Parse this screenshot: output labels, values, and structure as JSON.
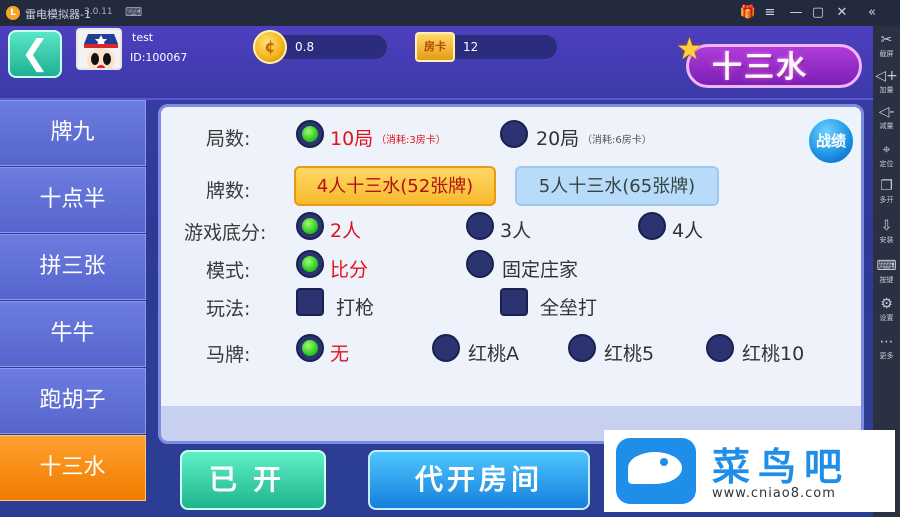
{
  "window": {
    "title": "雷电模拟器-1",
    "version": "3.0.11",
    "controls": [
      "🎁",
      "≡",
      "—",
      "▢",
      "✕",
      "«"
    ]
  },
  "toolbar": [
    {
      "icon": "✂",
      "label": "截屏"
    },
    {
      "icon": "◁+",
      "label": "加量"
    },
    {
      "icon": "◁-",
      "label": "减量"
    },
    {
      "icon": "⌖",
      "label": "定位"
    },
    {
      "icon": "❐",
      "label": "多开"
    },
    {
      "icon": "⇩",
      "label": "安装"
    },
    {
      "icon": "⌨",
      "label": "按键"
    },
    {
      "icon": "⚙",
      "label": "设置"
    },
    {
      "icon": "⋯",
      "label": "更多"
    }
  ],
  "user": {
    "name": "test",
    "id": "ID:100067"
  },
  "resources": {
    "coins": "0.8",
    "card_icon_label": "房卡",
    "cards": "12"
  },
  "game_title": "十三水",
  "sidebar": [
    {
      "label": "牌九",
      "active": false
    },
    {
      "label": "十点半",
      "active": false
    },
    {
      "label": "拼三张",
      "active": false
    },
    {
      "label": "牛牛",
      "active": false
    },
    {
      "label": "跑胡子",
      "active": false
    },
    {
      "label": "十三水",
      "active": true
    }
  ],
  "settings": {
    "rounds": {
      "label": "局数:",
      "options": [
        {
          "text": "10局",
          "note": "（消耗:3房卡）",
          "selected": true
        },
        {
          "text": "20局",
          "note": "（消耗:6房卡）",
          "selected": false
        }
      ]
    },
    "cards": {
      "label": "牌数:",
      "options": [
        {
          "text": "4人十三水(52张牌)",
          "selected": true
        },
        {
          "text": "5人十三水(65张牌)",
          "selected": false
        }
      ]
    },
    "players": {
      "label": "游戏底分:",
      "options": [
        {
          "text": "2人",
          "selected": true
        },
        {
          "text": "3人",
          "selected": false
        },
        {
          "text": "4人",
          "selected": false
        }
      ]
    },
    "mode": {
      "label": "模式:",
      "options": [
        {
          "text": "比分",
          "selected": true
        },
        {
          "text": "固定庄家",
          "selected": false
        }
      ]
    },
    "play": {
      "label": "玩法:",
      "options": [
        {
          "text": "打枪",
          "checked": false
        },
        {
          "text": "全垒打",
          "checked": false
        }
      ]
    },
    "horse": {
      "label": "马牌:",
      "options": [
        {
          "text": "无",
          "selected": true
        },
        {
          "text": "红桃A",
          "selected": false
        },
        {
          "text": "红桃5",
          "selected": false
        },
        {
          "text": "红桃10",
          "selected": false
        }
      ]
    }
  },
  "record_button": "战绩",
  "buttons": {
    "opened": "已开",
    "proxy_open": "代开房间"
  },
  "watermark": {
    "text": "菜鸟吧",
    "url": "www.cniao8.com"
  },
  "colors": {
    "accent_red": "#e0141a",
    "active_tab": "#f07b00",
    "selected_green": "#22c21a"
  }
}
